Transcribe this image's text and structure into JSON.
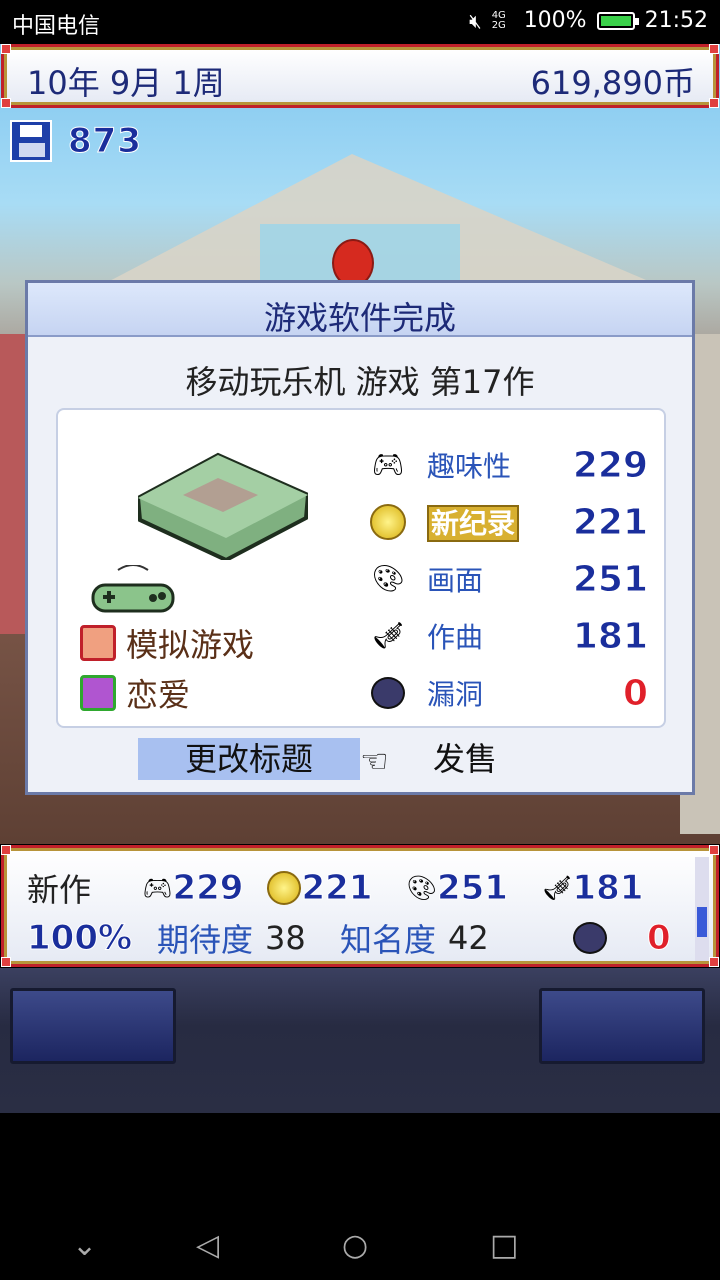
{
  "status_bar": {
    "carrier": "中国电信",
    "network": "4G 2G",
    "battery": "100%",
    "time": "21:52",
    "battery_level": 1.0
  },
  "header": {
    "date": "10年 9月 1周",
    "money": "619,890币"
  },
  "save": {
    "count": "873"
  },
  "dialog": {
    "title": "游戏软件完成",
    "subtitle": "移动玩乐机 游戏 第17作",
    "genres": [
      {
        "label": "模拟游戏",
        "icon": "face-icon"
      },
      {
        "label": "恋爱",
        "icon": "gem-icon"
      }
    ],
    "stats": [
      {
        "icon": "controller-icon",
        "label": "趣味性",
        "value": "229"
      },
      {
        "icon": "gold-coin-icon",
        "label": "新纪录",
        "value": "221",
        "badge": true
      },
      {
        "icon": "paint-icon",
        "label": "画面",
        "value": "251"
      },
      {
        "icon": "trumpet-icon",
        "label": "作曲",
        "value": "181"
      },
      {
        "icon": "bug-icon",
        "label": "漏洞",
        "value": "0"
      }
    ],
    "change_title": "更改标题",
    "sell": "发售"
  },
  "bottom_bar": {
    "new_label": "新作",
    "progress": "100%",
    "fun": "229",
    "creativity": "221",
    "graphics": "251",
    "sound": "181",
    "expectation_label": "期待度",
    "expectation": "38",
    "fame_label": "知名度",
    "fame": "42",
    "bugs": "0"
  },
  "colors": {
    "accent": "#1d2a78",
    "frame_gold": "#b8943a",
    "frame_red": "#c0202a",
    "highlight": "#a8c0f0"
  }
}
